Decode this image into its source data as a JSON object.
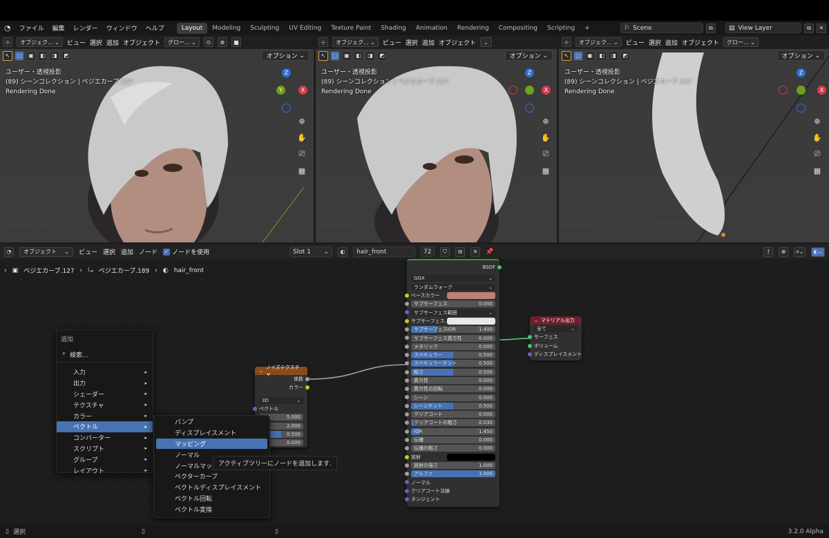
{
  "menubar": {
    "items": [
      "ファイル",
      "編集",
      "レンダー",
      "ウィンドウ",
      "ヘルプ"
    ],
    "workspaces": [
      "Layout",
      "Modeling",
      "Sculpting",
      "UV Editing",
      "Texture Paint",
      "Shading",
      "Animation",
      "Rendering",
      "Compositing",
      "Scripting"
    ],
    "active_workspace": "Layout",
    "add_tab": "+",
    "scene": "Scene",
    "view_layer": "View Layer"
  },
  "viewports": [
    {
      "mode": "オブジェク...",
      "menus": [
        "ビュー",
        "選択",
        "追加",
        "オブジェクト"
      ],
      "transform": "グロー...",
      "options": "オプション",
      "info": [
        "ユーザー・透視投影",
        "(89) シーンコレクション | ベジエカーブ.127",
        "Rendering Done"
      ]
    },
    {
      "mode": "オブジェク...",
      "menus": [
        "ビュー",
        "選択",
        "追加",
        "オブジェクト"
      ],
      "transform": "",
      "options": "オプション",
      "info": [
        "ユーザー・透視投影",
        "(89) シーンコレクション | ベジエカーブ.127",
        "Rendering Done"
      ]
    },
    {
      "mode": "オブジェク...",
      "menus": [
        "ビュー",
        "選択",
        "追加",
        "オブジェクト"
      ],
      "transform": "グロー...",
      "options": "オプション",
      "info": [
        "ユーザー・透視投影",
        "(89) シーンコレクション | ベジエカーブ.127",
        "Rendering Done"
      ]
    }
  ],
  "node_editor": {
    "mode": "オブジェクト",
    "menus": [
      "ビュー",
      "選択",
      "追加",
      "ノード"
    ],
    "use_nodes": "ノードを使用",
    "slot": "Slot 1",
    "material": "hair_front",
    "users": "72",
    "breadcrumb": [
      "ベジエカーブ.127",
      "ベジエカーブ.189",
      "hair_front"
    ]
  },
  "noise_node": {
    "title": "ノイズテクスチャ",
    "outputs": [
      "係数",
      "カラー"
    ],
    "dim": "3D",
    "vector": "ベクトル",
    "rows": [
      {
        "label": "ール",
        "value": "5.000"
      },
      {
        "label": "さ",
        "value": "2.000"
      },
      {
        "label": "",
        "value": "0.500"
      },
      {
        "label": "",
        "value": "0.000"
      }
    ]
  },
  "bsdf_node": {
    "output": "BSDF",
    "dist": "GGX",
    "sss_method": "ランダムウォーク",
    "rows": [
      {
        "label": "ベースカラー",
        "type": "color",
        "color": "#b98373"
      },
      {
        "label": "サブサーフェス",
        "value": "0.000",
        "fill": 0
      },
      {
        "label": "サブサーフェス範囲",
        "type": "drop"
      },
      {
        "label": "サブサーフェス...",
        "type": "color",
        "color": "#e8e8e8"
      },
      {
        "label": "サブサーフェスIOR",
        "value": "1.400",
        "fill": 0.3
      },
      {
        "label": "サブサーフェス異方性",
        "value": "0.000",
        "fill": 0
      },
      {
        "label": "メタリック",
        "value": "0.000",
        "fill": 0
      },
      {
        "label": "スペキュラー",
        "value": "0.500",
        "fill": 0.5
      },
      {
        "label": "スペキュラーチント",
        "value": "0.500",
        "fill": 0.5
      },
      {
        "label": "粗さ",
        "value": "0.500",
        "fill": 0.5
      },
      {
        "label": "異方性",
        "value": "0.000",
        "fill": 0
      },
      {
        "label": "異方性の回転",
        "value": "0.000",
        "fill": 0
      },
      {
        "label": "シーン",
        "value": "0.000",
        "fill": 0
      },
      {
        "label": "シーンチント",
        "value": "0.500",
        "fill": 0.5
      },
      {
        "label": "クリアコート",
        "value": "0.000",
        "fill": 0
      },
      {
        "label": "クリアコートの粗さ",
        "value": "0.030",
        "fill": 0.03
      },
      {
        "label": "IOR",
        "value": "1.450",
        "fill": 0.1
      },
      {
        "label": "伝播",
        "value": "0.000",
        "fill": 0
      },
      {
        "label": "伝播の粗さ",
        "value": "0.000",
        "fill": 0
      },
      {
        "label": "放射",
        "type": "color",
        "color": "#000000"
      },
      {
        "label": "放射の強さ",
        "value": "1.000",
        "fill": 0
      },
      {
        "label": "アルファ",
        "value": "1.000",
        "fill": 1
      },
      {
        "label": "ノーマル",
        "type": "socket"
      },
      {
        "label": "クリアコート法線",
        "type": "socket"
      },
      {
        "label": "タンジェント",
        "type": "socket"
      }
    ]
  },
  "output_node": {
    "title": "マテリアル出力",
    "target": "全て",
    "inputs": [
      "サーフェス",
      "ボリューム",
      "ディスプレイスメント"
    ]
  },
  "add_menu": {
    "title": "追加",
    "search": "検索...",
    "items": [
      "入力",
      "出力",
      "シェーダー",
      "テクスチャ",
      "カラー",
      "ベクトル",
      "コンバーター",
      "スクリプト",
      "グループ",
      "レイアウト"
    ],
    "highlighted": "ベクトル"
  },
  "vector_submenu": {
    "items": [
      "バンプ",
      "ディスプレイスメント",
      "マッピング",
      "ノーマル",
      "ノーマルマップ",
      "ベクターカーブ",
      "ベクトルディスプレイスメント",
      "ベクトル回転",
      "ベクトル変換"
    ],
    "highlighted": "マッピング"
  },
  "tooltip": "アクティブツリーにノードを追加します.",
  "status": {
    "left": "選択",
    "version": "3.2.0 Alpha"
  }
}
